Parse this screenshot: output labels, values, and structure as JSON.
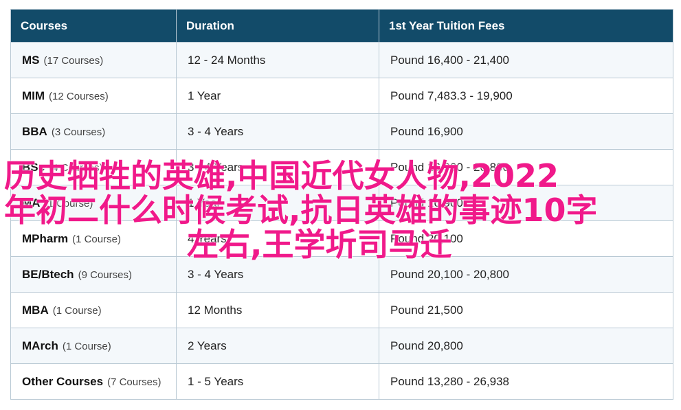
{
  "table": {
    "headers": [
      "Courses",
      "Duration",
      "1st Year Tuition Fees"
    ],
    "rows": [
      {
        "course": "MS",
        "count": "(17 Courses)",
        "duration": "12 - 24 Months",
        "fees": "Pound 16,400 - 21,400"
      },
      {
        "course": "MIM",
        "count": "(12 Courses)",
        "duration": "1 Year",
        "fees": "Pound 7,483.3 - 19,900"
      },
      {
        "course": "BBA",
        "count": "(3 Courses)",
        "duration": "3 - 4 Years",
        "fees": "Pound 16,900"
      },
      {
        "course": "BSc",
        "count": "(4 Courses)",
        "duration": "3 - 4 Years",
        "fees": "Pound 16,900 - 20,800"
      },
      {
        "course": "MA",
        "count": "(1 Course)",
        "duration": "1 Year",
        "fees": "Pound 16,900"
      },
      {
        "course": "MPharm",
        "count": "(1 Course)",
        "duration": "4 Years",
        "fees": "Pound 20,100"
      },
      {
        "course": "BE/Btech",
        "count": "(9 Courses)",
        "duration": "3 - 4 Years",
        "fees": "Pound 20,100 - 20,800"
      },
      {
        "course": "MBA",
        "count": "(1 Course)",
        "duration": "12 Months",
        "fees": "Pound 21,500"
      },
      {
        "course": "MArch",
        "count": "(1 Course)",
        "duration": "2 Years",
        "fees": "Pound 20,800"
      },
      {
        "course": "Other Courses",
        "count": "(7 Courses)",
        "duration": "1 - 5 Years",
        "fees": "Pound 13,280 - 26,938"
      }
    ]
  },
  "overlay": {
    "lines": [
      "历史牺牲的英雄,中国近代女人物,2022",
      "年初二什么时候考试,抗日英雄的事迹10字",
      "左右,王学圻司马迁"
    ],
    "color": "#f0198a"
  },
  "colors": {
    "header_bg": "#124b69",
    "header_text": "#ffffff",
    "row_alt_bg": "#f4f8fb",
    "border": "#b9c9d4"
  }
}
